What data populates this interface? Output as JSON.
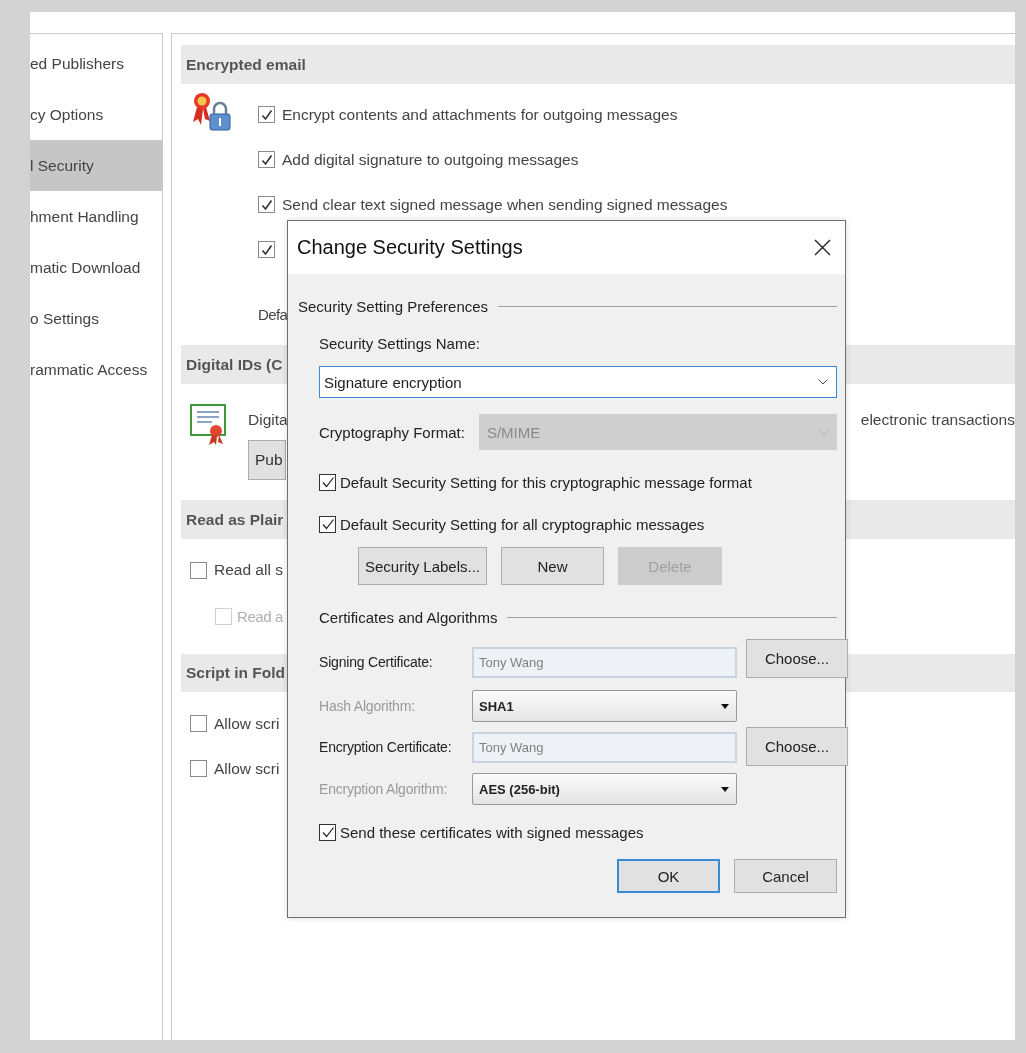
{
  "sidebar": {
    "items": [
      {
        "label": "ed Publishers",
        "selected": false
      },
      {
        "label": "cy Options",
        "selected": false
      },
      {
        "label": "l Security",
        "selected": true
      },
      {
        "label": "hment Handling",
        "selected": false
      },
      {
        "label": "matic Download",
        "selected": false
      },
      {
        "label": "o Settings",
        "selected": false
      },
      {
        "label": "rammatic Access",
        "selected": false
      }
    ]
  },
  "encrypted_email": {
    "title": "Encrypted email",
    "options": [
      {
        "label": "Encrypt contents and attachments for outgoing messages",
        "checked": true
      },
      {
        "label": "Add digital signature to outgoing messages",
        "checked": true
      },
      {
        "label": "Send clear text signed message when sending signed messages",
        "checked": true
      },
      {
        "checked": true
      }
    ],
    "default_setting_label": "Defa"
  },
  "digital_ids": {
    "title": "Digital IDs (C",
    "description": "Digita",
    "description_end": "electronic transactions",
    "button": "Pub"
  },
  "read_as_plain_text": {
    "title": "Read as Plair",
    "options": [
      {
        "label": "Read all s",
        "checked": false,
        "disabled": false
      },
      {
        "label": "Read a",
        "checked": false,
        "disabled": true
      }
    ]
  },
  "script_in_folders": {
    "title": "Script in Fold",
    "options": [
      {
        "label": "Allow scri",
        "checked": false,
        "disabled": false
      },
      {
        "label": "Allow scri",
        "checked": false,
        "disabled": false
      }
    ]
  },
  "dialog": {
    "title": "Change Security Settings",
    "preferences": {
      "heading": "Security Setting Preferences",
      "name_label": "Security Settings Name:",
      "name_value": "Signature encryption",
      "format_label": "Cryptography Format:",
      "format_value": "S/MIME",
      "format_disabled": true
    },
    "defaults": [
      {
        "label": "Default Security Setting for this cryptographic message format",
        "checked": true
      },
      {
        "label": "Default Security Setting for all cryptographic messages",
        "checked": true
      }
    ],
    "buttons": [
      {
        "label": "Security Labels...",
        "disabled": false
      },
      {
        "label": "New",
        "disabled": false
      },
      {
        "label": "Delete",
        "disabled": true
      }
    ],
    "certificates": {
      "heading": "Certificates and Algorithms",
      "rows": [
        {
          "kind": "certificate",
          "label": "Signing Certificate:",
          "value": "Tony Wang",
          "button": "Choose...",
          "label_disabled": false
        },
        {
          "kind": "select",
          "label": "Hash Algorithm:",
          "value": "SHA1",
          "label_disabled": true
        },
        {
          "kind": "certificate",
          "label": "Encryption Certificate:",
          "value": "Tony Wang",
          "button": "Choose...",
          "label_disabled": false
        },
        {
          "kind": "select",
          "label": "Encryption Algorithm:",
          "value": "AES (256-bit)",
          "label_disabled": true
        }
      ]
    },
    "send_certificates": {
      "label": "Send these certificates with signed messages",
      "checked": true
    },
    "actions": [
      {
        "label": "OK",
        "default": true
      },
      {
        "label": "Cancel",
        "default": false
      }
    ]
  }
}
